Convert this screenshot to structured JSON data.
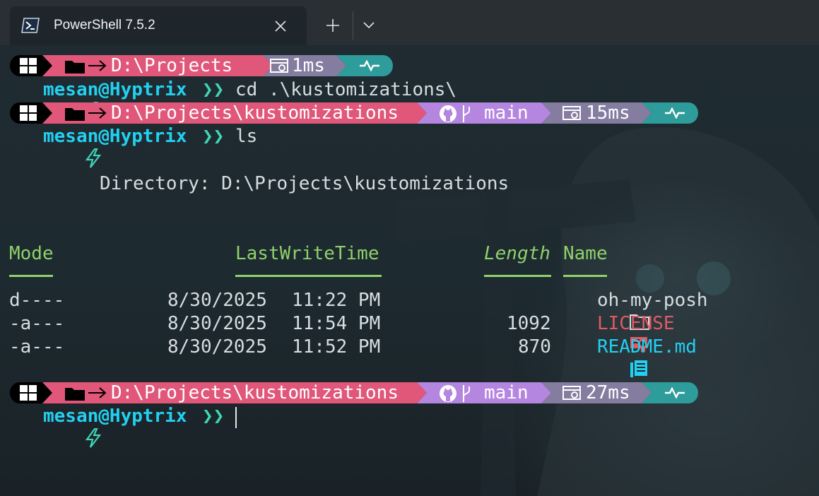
{
  "tab": {
    "title": "PowerShell 7.5.2",
    "icon": "powershell-icon"
  },
  "colors": {
    "os_segment": "#000000",
    "path_segment": "#e0577a",
    "git_segment": "#b586e0",
    "time_segment": "#857da0",
    "status_segment": "#2d9c9a",
    "user": "#23d0f0",
    "header": "#8fd16a",
    "license": "#e05a63",
    "readme": "#23d0f0"
  },
  "prompts": [
    {
      "path": "D:\\Projects",
      "branch": "",
      "time": "1ms"
    },
    {
      "path": "D:\\Projects\\kustomizations",
      "branch": "main",
      "time": "15ms"
    },
    {
      "path": "D:\\Projects\\kustomizations",
      "branch": "main",
      "time": "27ms"
    }
  ],
  "user": "mesan@Hyptrix",
  "arrows": "❯❯",
  "commands": [
    "cd .\\kustomizations\\",
    "ls",
    ""
  ],
  "listing": {
    "directory_label": "Directory: D:\\Projects\\kustomizations",
    "headers": {
      "mode": "Mode",
      "time": "LastWriteTime",
      "length": "Length",
      "name": "Name"
    },
    "rows": [
      {
        "mode": "d----",
        "date": "8/30/2025",
        "time": "11:22 PM",
        "length": "",
        "name": "oh-my-posh",
        "icon": "folder-icon"
      },
      {
        "mode": "-a---",
        "date": "8/30/2025",
        "time": "11:54 PM",
        "length": "1092",
        "name": "LICENSE",
        "icon": "certificate-icon"
      },
      {
        "mode": "-a---",
        "date": "8/30/2025",
        "time": "11:52 PM",
        "length": "870",
        "name": "README.md",
        "icon": "readme-book-icon"
      }
    ]
  }
}
